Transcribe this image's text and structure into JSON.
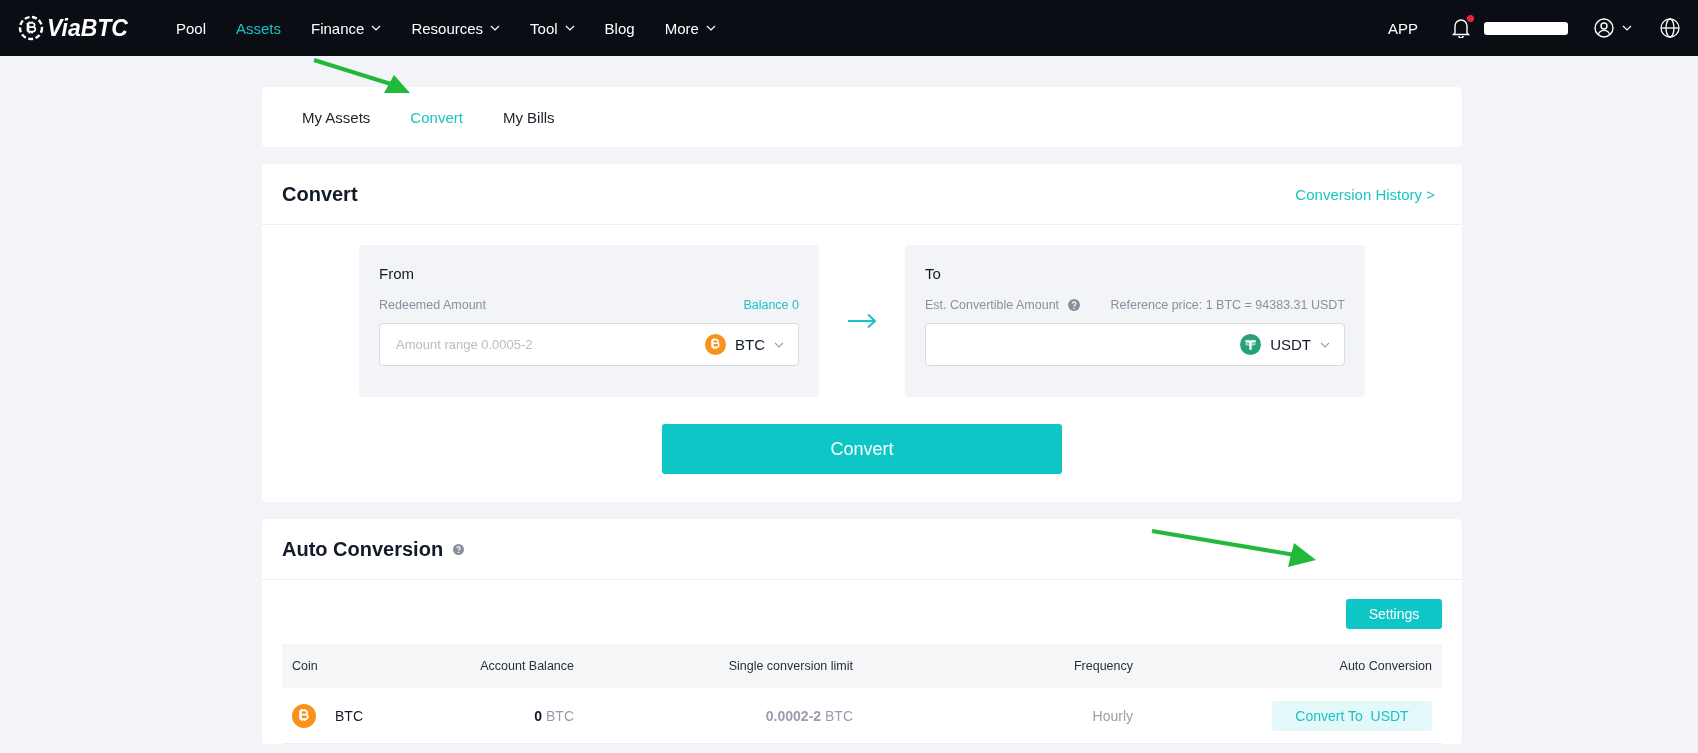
{
  "nav": {
    "logo": "ViaBTC",
    "items": [
      {
        "label": "Pool",
        "selected": false,
        "dropdown": false
      },
      {
        "label": "Assets",
        "selected": true,
        "dropdown": false
      },
      {
        "label": "Finance",
        "selected": false,
        "dropdown": true
      },
      {
        "label": "Resources",
        "selected": false,
        "dropdown": true
      },
      {
        "label": "Tool",
        "selected": false,
        "dropdown": true
      },
      {
        "label": "Blog",
        "selected": false,
        "dropdown": false
      },
      {
        "label": "More",
        "selected": false,
        "dropdown": true
      }
    ],
    "app": "APP",
    "unread": true
  },
  "tabs": [
    {
      "label": "My Assets",
      "selected": false
    },
    {
      "label": "Convert",
      "selected": true
    },
    {
      "label": "My Bills",
      "selected": false
    }
  ],
  "convert": {
    "title": "Convert",
    "history_link": "Conversion History >",
    "from": {
      "label": "From",
      "field_label": "Redeemed Amount",
      "balance": "Balance 0",
      "placeholder": "Amount range 0.0005-2",
      "coin": {
        "symbol": "BTC",
        "kind": "bitcoin"
      }
    },
    "to": {
      "label": "To",
      "field_label": "Est. Convertible Amount",
      "reference": "Reference price: 1 BTC = 94383.31 USDT",
      "coin": {
        "symbol": "USDT",
        "kind": "tether"
      }
    },
    "button": "Convert"
  },
  "auto": {
    "title": "Auto Conversion",
    "settings": "Settings",
    "columns": [
      "Coin",
      "Account Balance",
      "Single conversion limit",
      "Frequency",
      "Auto Conversion"
    ],
    "rows": [
      {
        "coin": {
          "symbol": "BTC",
          "kind": "bitcoin"
        },
        "balance": "**0** BTC",
        "limit": "**0.0002-2** BTC",
        "frequency": "Hourly",
        "action": "Convert To  USDT"
      }
    ]
  }
}
